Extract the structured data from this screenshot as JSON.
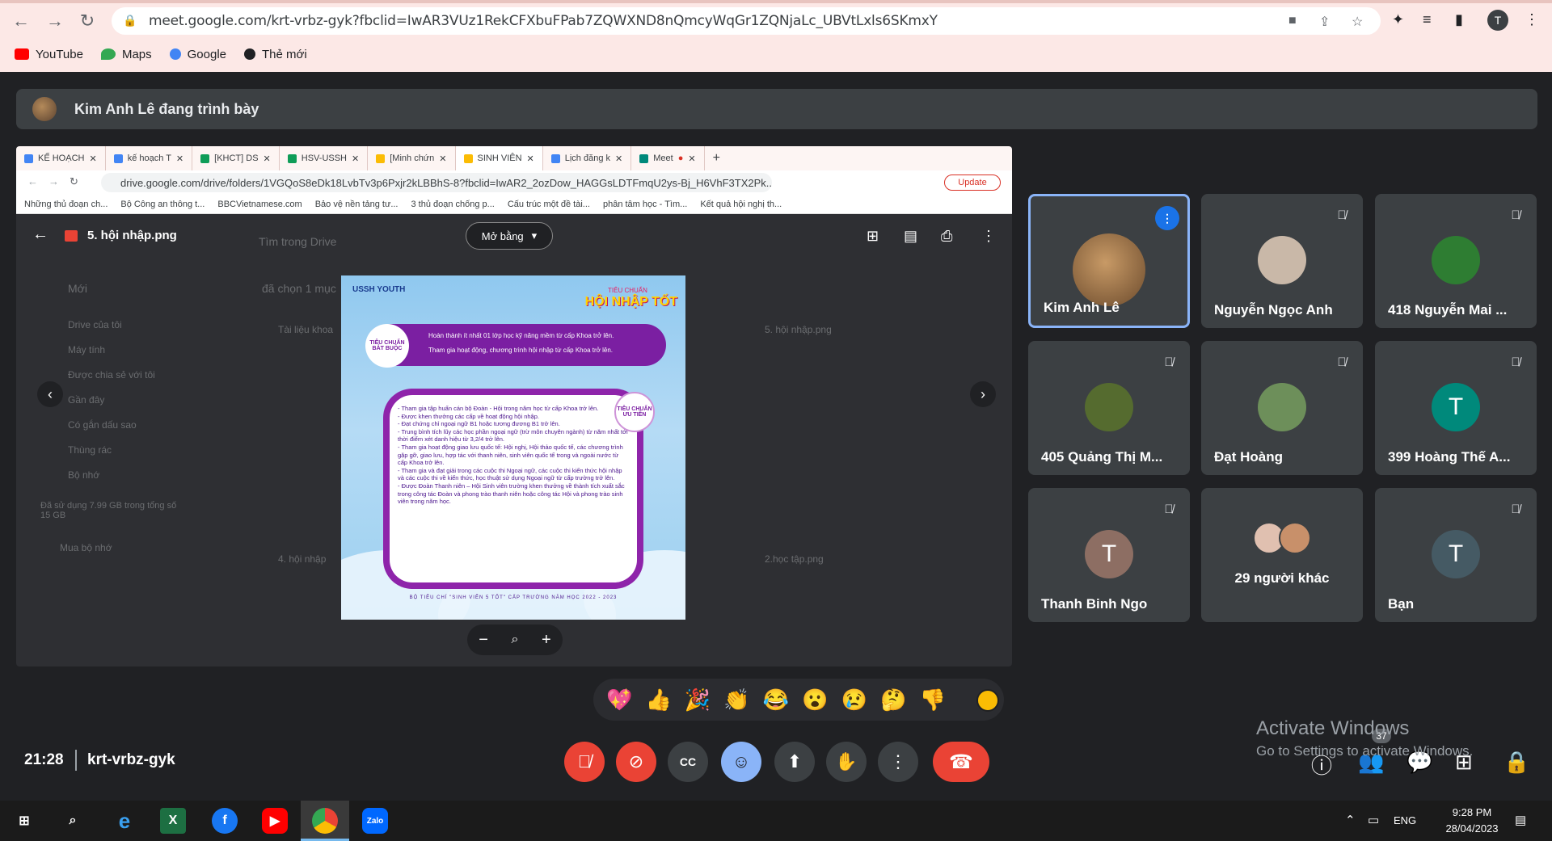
{
  "browser": {
    "url": "meet.google.com/krt-vrbz-gyk?fbclid=IwAR3VUz1RekCFXbuFPab7ZQWXND8nQmcyWqGr1ZQNjaLc_UBVtLxls6SKmxY",
    "profile_letter": "T",
    "bookmarks": [
      {
        "label": "YouTube",
        "color": "#ff0000"
      },
      {
        "label": "Maps",
        "color": "#34a853"
      },
      {
        "label": "Google",
        "color": "#4285f4"
      },
      {
        "label": "Thẻ mới",
        "color": "#202124"
      }
    ]
  },
  "presenter": {
    "label": "Kim Anh Lê đang trình bày"
  },
  "shared_screen": {
    "tabs": [
      {
        "label": "KẾ HOẠCH",
        "color": "#4285f4"
      },
      {
        "label": "kế hoạch T",
        "color": "#4285f4"
      },
      {
        "label": "[KHCT] DS",
        "color": "#0f9d58"
      },
      {
        "label": "HSV-USSH",
        "color": "#0f9d58"
      },
      {
        "label": "[Minh chứn",
        "color": "#fbbc04"
      },
      {
        "label": "SINH VIÊN",
        "color": "#fbbc04"
      },
      {
        "label": "Lịch đăng k",
        "color": "#4285f4"
      },
      {
        "label": "Meet",
        "color": "#00897b"
      }
    ],
    "url": "drive.google.com/drive/folders/1VGQoS8eDk18LvbTv3p6Pxjr2kLBBhS-8?fbclid=IwAR2_2ozDow_HAGGsLDTFmqU2ys-Bj_H6VhF3TX2Pk...",
    "update_label": "Update",
    "bookmarks": [
      "Những thủ đoạn ch...",
      "Bộ Công an thông t...",
      "BBCVietnamese.com",
      "Bảo vệ nền tảng tư...",
      "3 thủ đoạn chống p...",
      "Cấu trúc một đề tài...",
      "phân tâm học - Tìm...",
      "Kết quả hội nghị th..."
    ],
    "file_name": "5. hội nhập.png",
    "open_with_label": "Mở bằng",
    "drive_ghost": {
      "search": "Tìm trong Drive",
      "new": "Mới",
      "selected": "đã chọn 1 mục",
      "nav": [
        "Drive của tôi",
        "Máy tính",
        "Được chia sẻ với tôi",
        "Gần đây",
        "Có gắn dấu sao",
        "Thùng rác",
        "Bộ nhớ"
      ],
      "storage": "Đã sử dụng 7.99 GB trong tổng số 15 GB",
      "buy": "Mua bộ nhớ",
      "files": [
        "Tài liệu khoa",
        "5. hội nhập.png",
        "4. hội nhập",
        "2.học tập.png"
      ]
    },
    "poster": {
      "logo": "USSH YOUTH",
      "title_small": "TIÊU CHUẨN",
      "title": "HỘI NHẬP TỐT",
      "req_badge": "TIÊU CHUẨN BẮT BUỘC",
      "req_lines": [
        "Hoàn thành ít nhất 01 lớp học kỹ năng mềm từ cấp Khoa trở lên.",
        "Tham gia hoạt động, chương trình hội nhập từ cấp Khoa trở lên."
      ],
      "prio_badge": "TIÊU CHUẨN ƯU TIÊN",
      "prio_lines": [
        "- Tham gia tập huấn cán bộ Đoàn - Hội trong năm học từ cấp Khoa trở lên.",
        "- Được khen thưởng các cấp về hoạt động hội nhập.",
        "- Đạt chứng chỉ ngoại ngữ B1 hoặc tương đương B1 trở lên.",
        "- Trung bình tích lũy các học phần ngoại ngữ (trừ môn chuyên ngành) từ năm nhất tới thời điểm xét danh hiệu từ 3,2/4 trở lên.",
        "- Tham gia hoạt động giao lưu quốc tế: Hội nghị, Hội thảo quốc tế, các chương trình gặp gỡ, giao lưu, hợp tác với thanh niên, sinh viên quốc tế trong và ngoài nước từ cấp Khoa trở lên.",
        "- Tham gia và đạt giải trong các cuộc thi Ngoại ngữ, các cuộc thi kiến thức hội nhập và các cuộc thi về kiến thức, học thuật sử dụng Ngoại ngữ từ cấp trường trở lên.",
        "- Được Đoàn Thanh niên – Hội Sinh viên trường khen thưởng về thành tích xuất sắc trong công tác Đoàn và phong trào thanh niên hoặc công tác Hội và phong trào sinh viên trong năm học."
      ],
      "footer": "BỘ TIÊU CHÍ \"SINH VIÊN 5 TỐT\" CẤP TRƯỜNG NĂM HỌC 2022 - 2023"
    }
  },
  "participants": [
    {
      "name": "Kim Anh Lê",
      "avatar": "photo",
      "color": "#7a5a3a",
      "speaking": true
    },
    {
      "name": "Nguyễn Ngọc Anh",
      "avatar": "photo",
      "color": "#c9b8a8",
      "speaking": false
    },
    {
      "name": "418 Nguyễn Mai ...",
      "avatar": "photo",
      "color": "#2e7d32",
      "speaking": false
    },
    {
      "name": "405 Quảng Thị M...",
      "avatar": "photo",
      "color": "#556b2f",
      "speaking": false
    },
    {
      "name": "Đạt Hoàng",
      "avatar": "photo",
      "color": "#6d8f5a",
      "speaking": false
    },
    {
      "name": "399 Hoàng Thế A...",
      "avatar": "T",
      "color": "#00897b",
      "speaking": false
    },
    {
      "name": "Thanh Binh Ngo",
      "avatar": "T",
      "color": "#8d6e63",
      "speaking": false
    },
    {
      "name": "29 người khác",
      "avatar": "group",
      "color": "#c8a090",
      "speaking": false
    },
    {
      "name": "Bạn",
      "avatar": "T",
      "color": "#455a64",
      "speaking": false
    }
  ],
  "reactions": [
    "💖",
    "👍",
    "🎉",
    "👏",
    "😂",
    "😮",
    "😢",
    "🤔",
    "👎"
  ],
  "meeting": {
    "time": "21:28",
    "code": "krt-vrbz-gyk",
    "people_count": "37"
  },
  "watermark": {
    "line1": "Activate Windows",
    "line2": "Go to Settings to activate Windows."
  },
  "taskbar": {
    "lang": "ENG",
    "time": "9:28 PM",
    "date": "28/04/2023"
  }
}
